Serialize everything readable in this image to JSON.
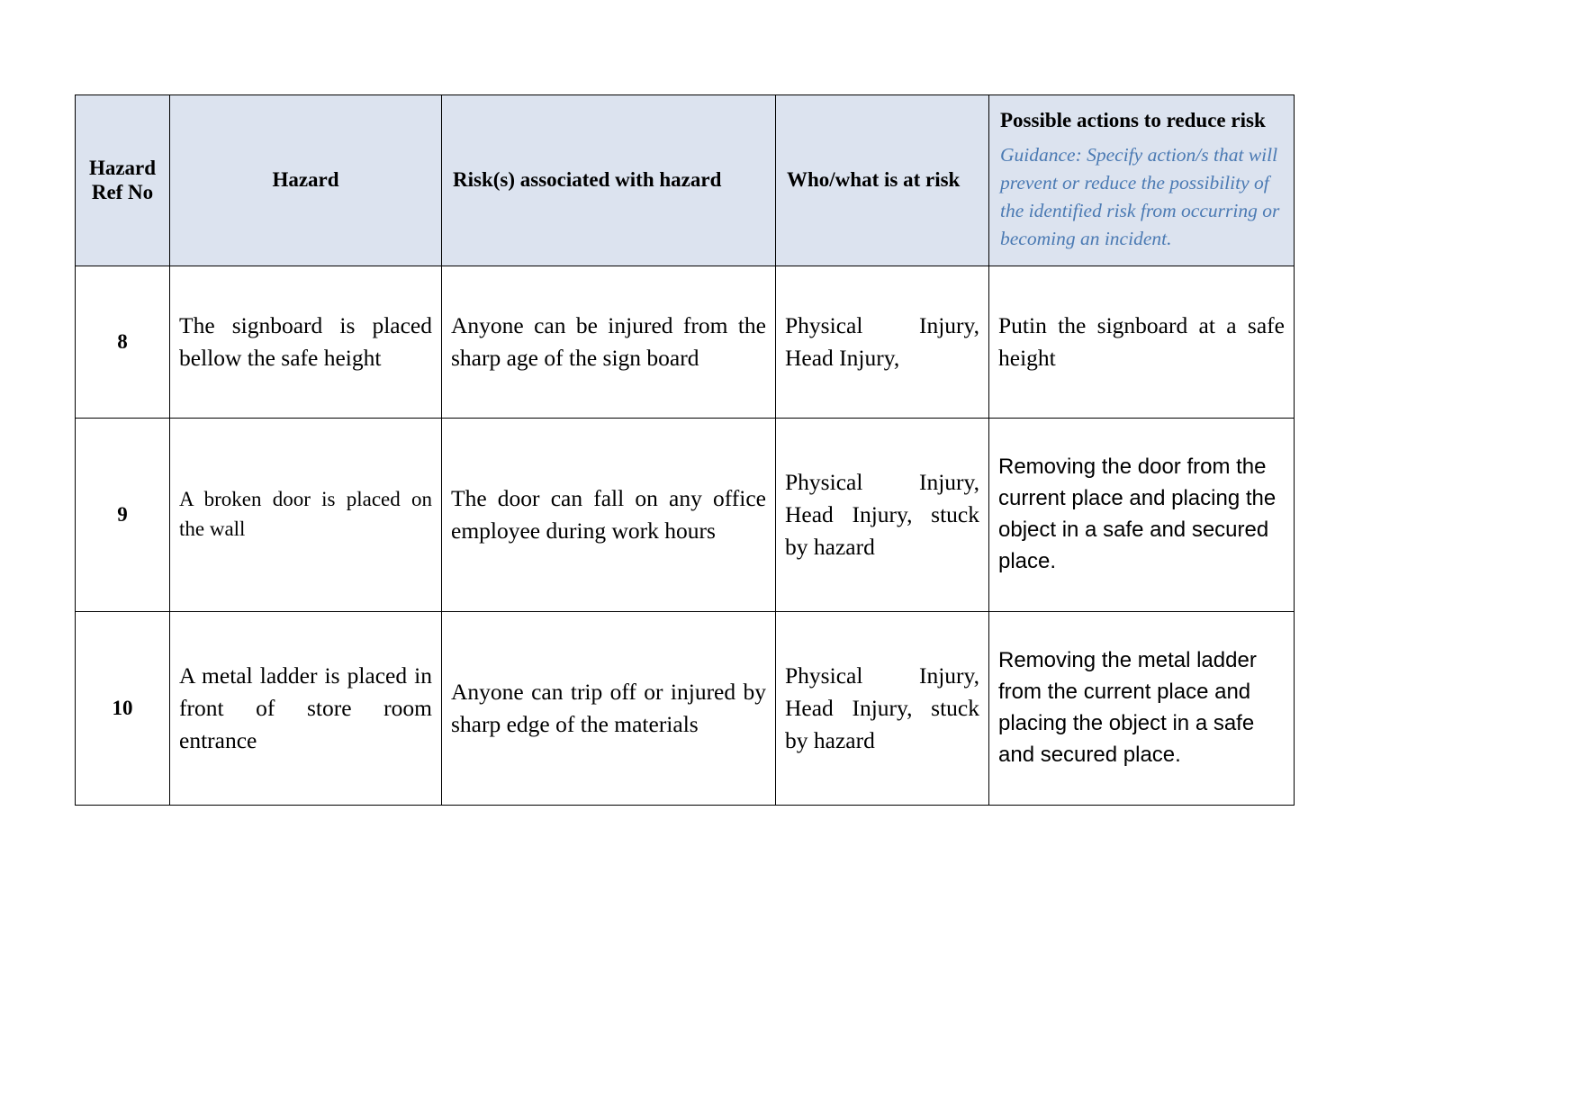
{
  "table": {
    "headers": [
      {
        "id": "hazard-ref-no",
        "label": "Hazard Ref No",
        "align": "center"
      },
      {
        "id": "hazard",
        "label": "Hazard",
        "align": "center"
      },
      {
        "id": "risks-associated-with-hazard",
        "label": "Risk(s) associated with hazard",
        "align": "left"
      },
      {
        "id": "who-what-is-at-risk",
        "label": "Who/what is at risk",
        "align": "left"
      },
      {
        "id": "possible-actions-to-reduce-risk",
        "label": "Possible actions to reduce risk",
        "align": "left"
      }
    ],
    "header_guidance": "Guidance: Specify action/s that will prevent or reduce the possibility of the identified risk from occurring or becoming an incident.",
    "rows": [
      {
        "ref_no": "8",
        "hazard": "The signboard is placed bellow the safe height",
        "risk": "Anyone can be injured from the sharp age of the sign board",
        "who_at_risk": "Physical Injury, Head Injury,",
        "action": "Putin the signboard at a safe height"
      },
      {
        "ref_no": "9",
        "hazard": "A broken door is placed on the wall",
        "risk": "The door can fall on any office employee during work hours",
        "who_at_risk": "Physical Injury, Head Injury, stuck by hazard",
        "action": "Removing the door from the current place and placing the object in a safe and secured place."
      },
      {
        "ref_no": "10",
        "hazard": "A metal ladder is placed in front of store room entrance",
        "risk": "Anyone can trip off or injured by sharp edge of the materials",
        "who_at_risk": "Physical Injury, Head Injury, stuck by hazard",
        "action": "Removing the metal ladder from the current place and placing the object in a safe and secured place."
      }
    ]
  },
  "colors": {
    "header_background": "#dce3ef",
    "guidance_text": "#4b7ab3",
    "border": "#000000",
    "body_text": "#000000",
    "page_background": "#ffffff"
  }
}
